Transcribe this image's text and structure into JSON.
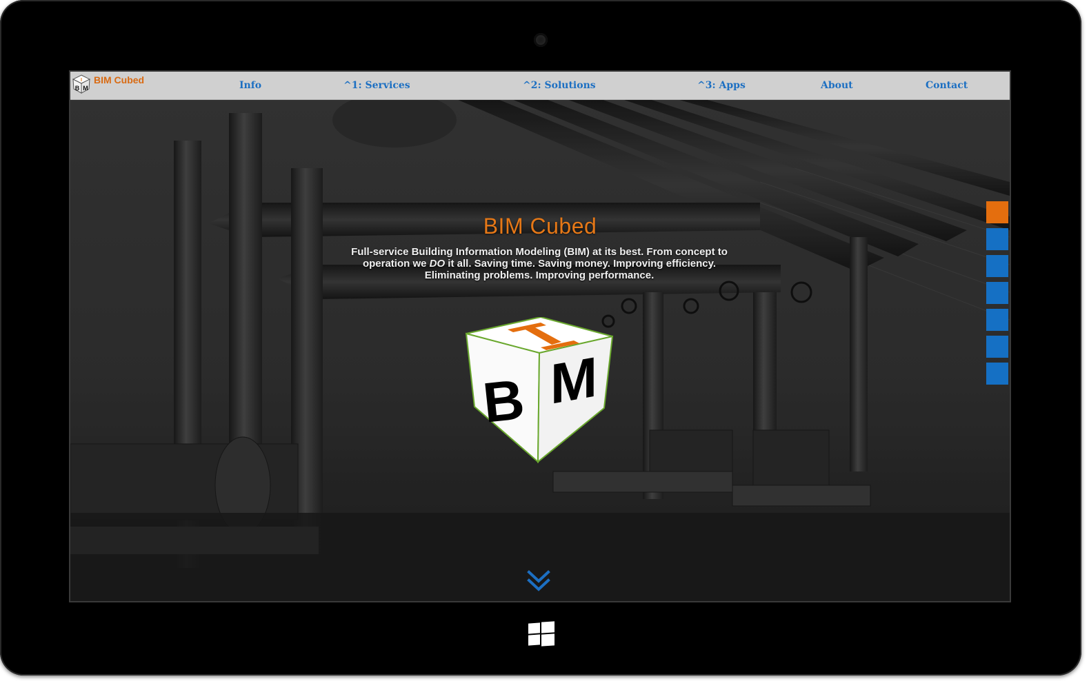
{
  "site": {
    "logo_text": "BIM Cubed",
    "logo_letters": [
      "I",
      "B",
      "M"
    ]
  },
  "nav": {
    "items": [
      {
        "label": "Info"
      },
      {
        "label": "^1: Services"
      },
      {
        "label": "^2: Solutions"
      },
      {
        "label": "^3: Apps"
      },
      {
        "label": "About"
      },
      {
        "label": "Contact"
      }
    ]
  },
  "hero": {
    "title": "BIM Cubed",
    "text_before": "Full-service Building Information Modeling (BIM) at its best. From concept to operation we ",
    "text_emphasis": "DO",
    "text_after": " it all. Saving time. Saving money. Improving efficiency. Eliminating problems. Improving performance."
  },
  "side_nav": {
    "count": 7,
    "active_index": 0
  },
  "colors": {
    "accent_orange": "#e67817",
    "link_blue": "#1c6fc2",
    "side_blue": "#1570c4",
    "navbar_bg": "#d0d0d0",
    "cube_edge_green": "#6aa82e"
  },
  "icons": {
    "scroll_down": "double-chevron-down-icon",
    "windows_button": "windows-logo-icon",
    "camera": "camera-icon"
  }
}
